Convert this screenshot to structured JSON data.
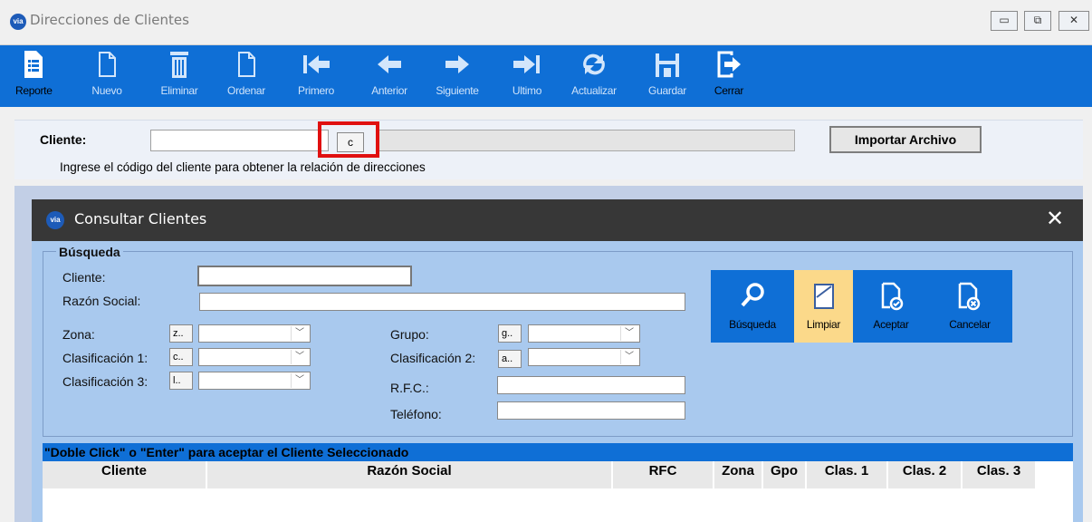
{
  "window": {
    "title": "Direcciones de Clientes",
    "logo_text": "via",
    "minimize": "▭",
    "maximize": "⧉",
    "close": "✕"
  },
  "toolbar": [
    {
      "label": "Reporte",
      "icon": "report-icon"
    },
    {
      "label": "Nuevo",
      "icon": "new-document-icon"
    },
    {
      "label": "Eliminar",
      "icon": "trash-icon"
    },
    {
      "label": "Ordenar",
      "icon": "sort-document-icon"
    },
    {
      "label": "Primero",
      "icon": "first-arrow-icon"
    },
    {
      "label": "Anterior",
      "icon": "previous-arrow-icon"
    },
    {
      "label": "Siguiente",
      "icon": "next-arrow-icon"
    },
    {
      "label": "Ultimo",
      "icon": "last-arrow-icon"
    },
    {
      "label": "Actualizar",
      "icon": "refresh-icon"
    },
    {
      "label": "Guardar",
      "icon": "save-icon"
    },
    {
      "label": "Cerrar",
      "icon": "exit-icon"
    }
  ],
  "form": {
    "cliente_label": "Cliente:",
    "cliente_value": "",
    "c_button": "c",
    "import_button": "Importar Archivo",
    "hint": "Ingrese el código del cliente para obtener la relación de direcciones"
  },
  "dialog": {
    "title": "Consultar Clientes",
    "logo_text": "via",
    "close": "✕",
    "group_label": "Búsqueda",
    "labels": {
      "cliente": "Cliente:",
      "razon_social": "Razón Social:",
      "zona": "Zona:",
      "clas1": "Clasificación 1:",
      "clas3": "Clasificación 3:",
      "grupo": "Grupo:",
      "clas2": "Clasificación 2:",
      "rfc": "R.F.C.:",
      "telefono": "Teléfono:"
    },
    "prefix_buttons": {
      "zona": "z..",
      "clas1": "c..",
      "clas3": "l..",
      "grupo": "g..",
      "clas2": "a.."
    },
    "actions": [
      {
        "label": "Búsqueda",
        "icon": "magnifier-icon"
      },
      {
        "label": "Limpiar",
        "icon": "eraser-icon"
      },
      {
        "label": "Aceptar",
        "icon": "accept-document-icon"
      },
      {
        "label": "Cancelar",
        "icon": "cancel-document-icon"
      }
    ],
    "grid_hint": "\"Doble Click\" o \"Enter\" para aceptar el Cliente Seleccionado",
    "columns": [
      "Cliente",
      "Razón Social",
      "RFC",
      "Zona",
      "Gpo",
      "Clas. 1",
      "Clas. 2",
      "Clas. 3"
    ]
  },
  "colors": {
    "toolbar": "#0f6fd6",
    "dialog_body": "#a9c9ee",
    "highlight": "#e01010",
    "limpiar": "#fbd98a"
  }
}
